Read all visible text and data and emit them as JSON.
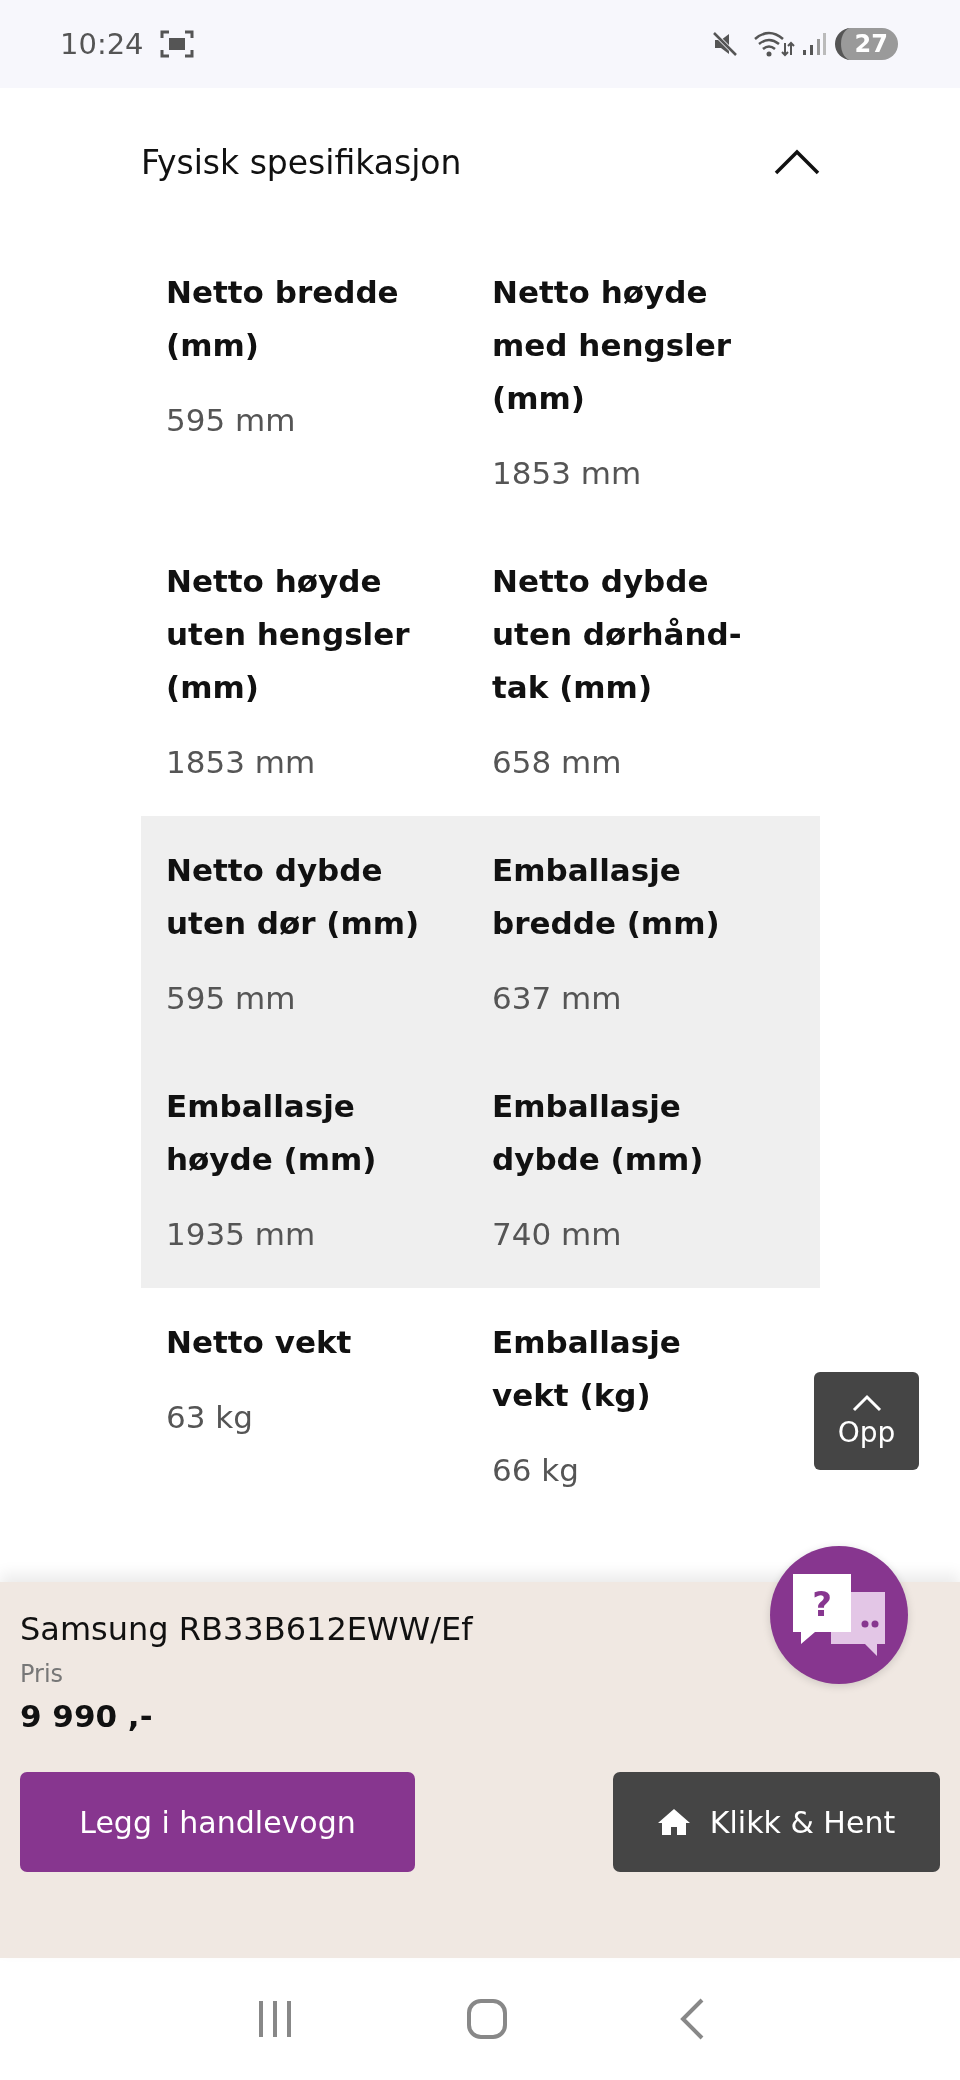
{
  "status_bar": {
    "time": "10:24",
    "battery": "27"
  },
  "section": {
    "title": "Fysisk spesifikasjon",
    "expanded": true,
    "rows": [
      {
        "highlighted": false,
        "items": [
          {
            "label": "Netto bredde (mm)",
            "value": "595 mm"
          },
          {
            "label": "Netto høyde med hengsler (mm)",
            "value": "1853 mm"
          }
        ]
      },
      {
        "highlighted": false,
        "items": [
          {
            "label": "Netto høyde uten hengsler (mm)",
            "value": "1853 mm"
          },
          {
            "label": "Netto dybde uten dørhånd-tak (mm)",
            "value": "658 mm"
          }
        ]
      },
      {
        "highlighted": true,
        "items": [
          {
            "label": "Netto dybde uten dør (mm)",
            "value": "595 mm"
          },
          {
            "label": "Emballasje bredde (mm)",
            "value": "637 mm"
          }
        ]
      },
      {
        "highlighted": true,
        "items": [
          {
            "label": "Emballasje høyde (mm)",
            "value": "1935 mm"
          },
          {
            "label": "Emballasje dybde (mm)",
            "value": "740 mm"
          }
        ]
      },
      {
        "highlighted": false,
        "items": [
          {
            "label": "Netto vekt",
            "value": "63 kg"
          },
          {
            "label": "Emballasje vekt (kg)",
            "value": "66 kg"
          }
        ]
      }
    ]
  },
  "scroll_top_button": {
    "label": "Opp"
  },
  "chat_button": {
    "icon": "?"
  },
  "product": {
    "name": "Samsung RB33B612EWW/Ef",
    "price_label": "Pris",
    "price": "9 990 ,-"
  },
  "buttons": [
    {
      "kind": "primary",
      "label": "Legg i handlevogn"
    },
    {
      "kind": "secondary",
      "label": "Klikk & Hent"
    }
  ]
}
